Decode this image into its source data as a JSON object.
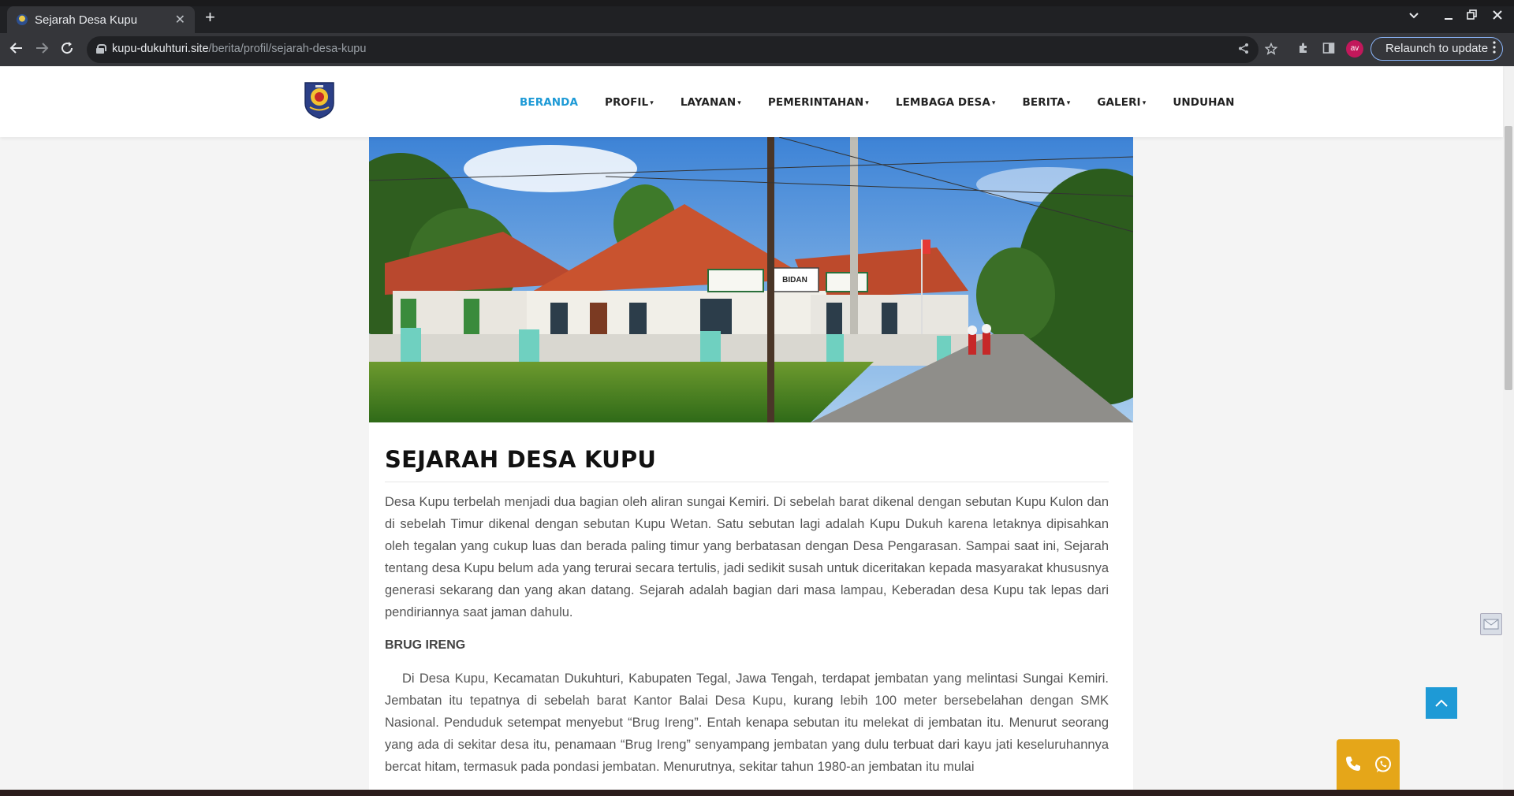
{
  "browser": {
    "tab_title": "Sejarah Desa Kupu",
    "tab_close": "✕",
    "new_tab": "+",
    "url_host": "kupu-dukuhturi.site",
    "url_path": "/berita/profil/sejarah-desa-kupu",
    "profile_initials": "av",
    "relaunch_label": "Relaunch to update"
  },
  "site": {
    "nav": [
      {
        "label": "BERANDA",
        "dropdown": false,
        "active": true
      },
      {
        "label": "PROFIL",
        "dropdown": true
      },
      {
        "label": "LAYANAN",
        "dropdown": true
      },
      {
        "label": "PEMERINTAHAN",
        "dropdown": true
      },
      {
        "label": "LEMBAGA DESA",
        "dropdown": true
      },
      {
        "label": "BERITA",
        "dropdown": true
      },
      {
        "label": "GALERI",
        "dropdown": true
      },
      {
        "label": "UNDUHAN",
        "dropdown": false
      }
    ],
    "caret": "▾",
    "hero_sign": "BIDAN"
  },
  "article": {
    "title": "SEJARAH DESA KUPU",
    "intro": "Desa Kupu terbelah menjadi dua bagian oleh aliran sungai Kemiri. Di sebelah barat dikenal dengan sebutan Kupu Kulon dan di sebelah Timur dikenal dengan sebutan Kupu Wetan. Satu sebutan lagi adalah Kupu Dukuh karena letaknya dipisahkan oleh tegalan yang cukup luas dan berada paling timur yang berbatasan dengan Desa Pengarasan. Sampai saat ini, Sejarah tentang desa Kupu belum ada yang terurai secara tertulis, jadi sedikit susah untuk diceritakan kepada masyarakat khususnya generasi sekarang dan yang akan datang. Sejarah adalah bagian dari masa lampau, Keberadan desa Kupu tak lepas dari pendiriannya saat jaman dahulu.",
    "subheading": "BRUG IRENG",
    "body": "Di Desa Kupu, Kecamatan Dukuhturi, Kabupaten Tegal, Jawa Tengah, terdapat jembatan yang melintasi Sungai Kemiri. Jembatan itu tepatnya di sebelah barat Kantor Balai Desa Kupu, kurang lebih 100 meter bersebelahan dengan SMK Nasional. Penduduk setempat menyebut “Brug Ireng”. Entah kenapa sebutan itu melekat di jembatan itu. Menurut seorang yang ada di sekitar desa itu, penamaan “Brug Ireng” senyampang jembatan yang dulu terbuat dari kayu jati keseluruhannya bercat hitam, termasuk pada pondasi jembatan. Menurutnya, sekitar tahun 1980-an jembatan itu mulai"
  },
  "colors": {
    "accent": "#1e9ad6",
    "contact_bg": "#e5a619"
  }
}
